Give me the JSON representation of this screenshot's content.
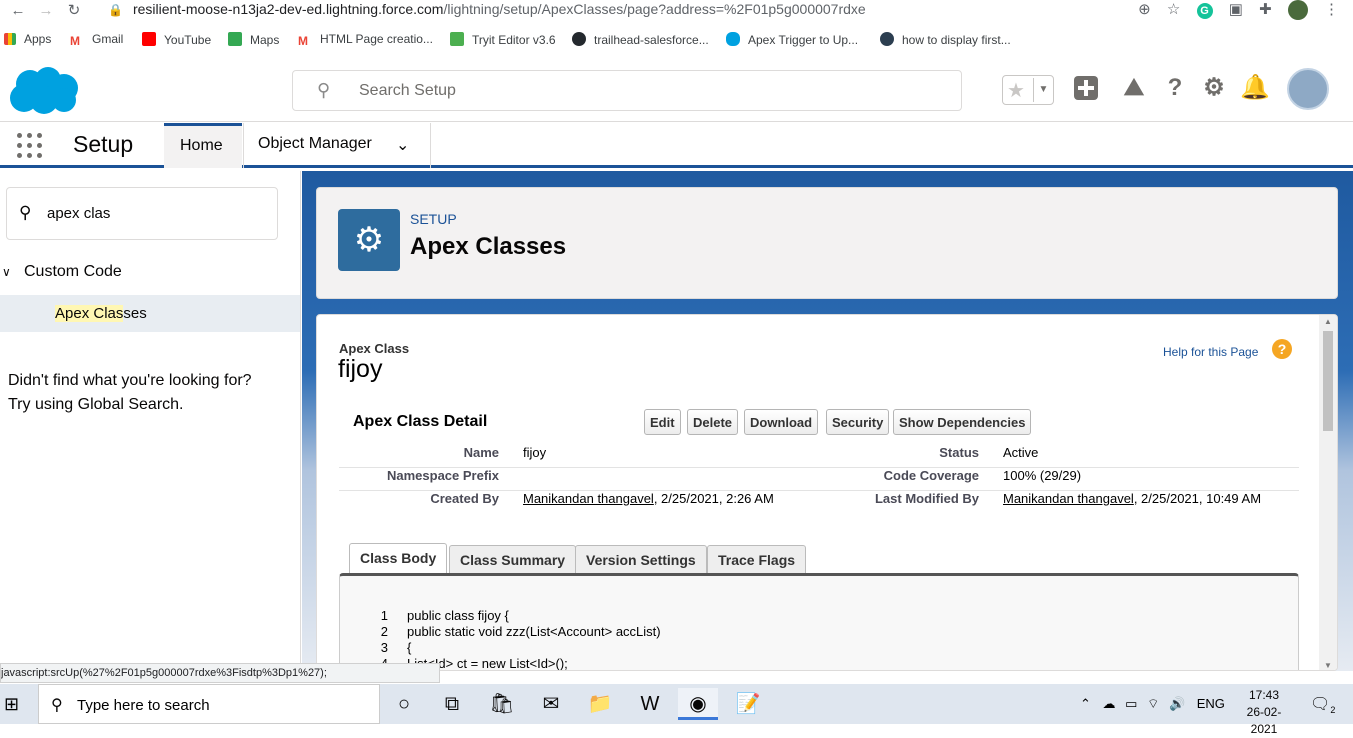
{
  "browser": {
    "url_host": "resilient-moose-n13ja2-dev-ed.lightning.force.com",
    "url_path": "/lightning/setup/ApexClasses/page?address=%2F01p5g000007rdxe",
    "bookmarks": [
      {
        "label": "Apps"
      },
      {
        "label": "Gmail"
      },
      {
        "label": "YouTube"
      },
      {
        "label": "Maps"
      },
      {
        "label": "HTML Page creatio..."
      },
      {
        "label": "Tryit Editor v3.6"
      },
      {
        "label": "trailhead-salesforce..."
      },
      {
        "label": "Apex Trigger to Up..."
      },
      {
        "label": "how to display first..."
      }
    ],
    "status_url": "javascript:srcUp(%27%2F01p5g000007rdxe%3Fisdtp%3Dp1%27);"
  },
  "header": {
    "search_placeholder": "Search Setup"
  },
  "nav": {
    "app_name": "Setup",
    "tab_home": "Home",
    "tab_object_manager": "Object Manager"
  },
  "sidebar": {
    "quick_find_value": "apex clas",
    "group_label": "Custom Code",
    "item_highlight": "Apex Clas",
    "item_rest": "ses",
    "not_found_line1": "Didn't find what you're looking for?",
    "not_found_line2": "Try using Global Search."
  },
  "page_header": {
    "eyebrow": "SETUP",
    "title": "Apex Classes"
  },
  "record": {
    "type_label": "Apex Class",
    "name": "fijoy",
    "help_link": "Help for this Page",
    "section_title": "Apex Class Detail",
    "buttons": [
      "Edit",
      "Delete",
      "Download",
      "Security",
      "Show Dependencies"
    ],
    "fields": {
      "name_label": "Name",
      "name_value": "fijoy",
      "status_label": "Status",
      "status_value": "Active",
      "namespace_label": "Namespace Prefix",
      "namespace_value": "",
      "coverage_label": "Code Coverage",
      "coverage_value": "100% (29/29)",
      "created_label": "Created By",
      "created_user": "Manikandan thangavel",
      "created_date": ", 2/25/2021, 2:26 AM",
      "modified_label": "Last Modified By",
      "modified_user": "Manikandan thangavel",
      "modified_date": ", 2/25/2021, 10:49 AM"
    },
    "tabs": [
      "Class Body",
      "Class Summary",
      "Version Settings",
      "Trace Flags"
    ],
    "code_lines": [
      {
        "n": "1",
        "text": "public class fijoy {"
      },
      {
        "n": "2",
        "text": "public static void zzz(List<Account> accList)"
      },
      {
        "n": "3",
        "text": "{"
      },
      {
        "n": "4",
        "text": "List<Id> ct = new List<Id>();"
      }
    ]
  },
  "taskbar": {
    "search_placeholder": "Type here to search",
    "lang": "ENG",
    "time": "17:43",
    "date": "26-02-2021",
    "notif_count": "2"
  },
  "colors": {
    "brand_blue": "#1b5297",
    "salesforce_cloud": "#00a1e0",
    "link": "#1b5297"
  }
}
